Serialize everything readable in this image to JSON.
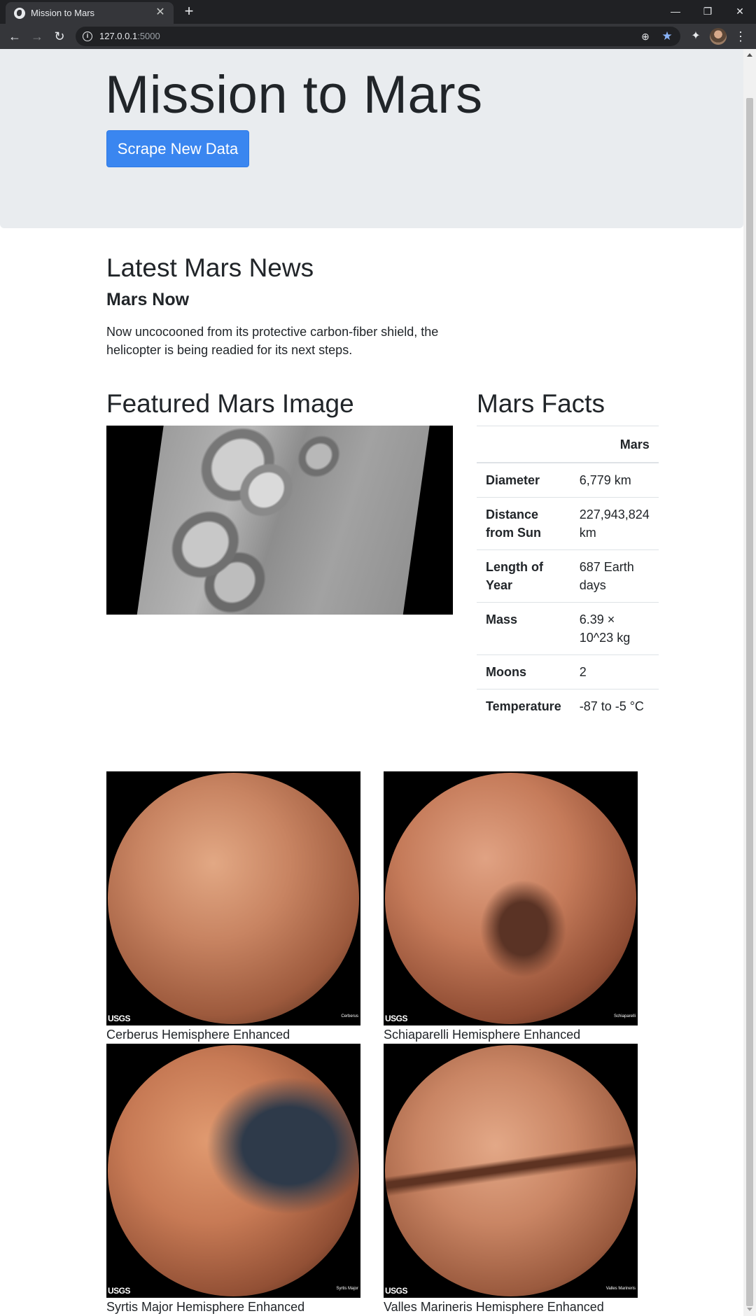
{
  "browser": {
    "tab_title": "Mission to Mars",
    "url_host": "127.0.0.1",
    "url_port": ":5000",
    "icons": {
      "favicon": "globe-icon",
      "back": "arrow-left-icon",
      "forward": "arrow-right-icon",
      "reload": "reload-icon",
      "info": "info-icon",
      "zoom": "zoom-icon",
      "bookmark": "star-icon",
      "extensions": "puzzle-icon",
      "menu": "kebab-menu-icon"
    }
  },
  "jumbotron": {
    "title": "Mission to Mars",
    "button_label": "Scrape New Data",
    "button_color": "#3a86f0"
  },
  "news": {
    "section_title": "Latest Mars News",
    "headline": "Mars Now",
    "teaser": "Now uncocooned from its protective carbon-fiber shield, the helicopter is being readied for its next steps."
  },
  "featured": {
    "section_title": "Featured Mars Image"
  },
  "facts": {
    "section_title": "Mars Facts",
    "column_header": "Mars",
    "rows": [
      {
        "label": "Diameter",
        "value": "6,779 km"
      },
      {
        "label": "Distance from Sun",
        "value": "227,943,824 km"
      },
      {
        "label": "Length of Year",
        "value": "687 Earth days"
      },
      {
        "label": "Mass",
        "value": "6.39 × 10^23 kg"
      },
      {
        "label": "Moons",
        "value": "2"
      },
      {
        "label": "Temperature",
        "value": "-87 to -5 °C"
      }
    ]
  },
  "hemispheres": [
    {
      "title": "Cerberus Hemisphere Enhanced",
      "image_label": "Cerberus"
    },
    {
      "title": "Schiaparelli Hemisphere Enhanced",
      "image_label": "Schiaparelli"
    },
    {
      "title": "Syrtis Major Hemisphere Enhanced",
      "image_label": "Syrtis Major"
    },
    {
      "title": "Valles Marineris Hemisphere Enhanced",
      "image_label": "Valles Marineris"
    }
  ],
  "usgs_logo": "USGS"
}
